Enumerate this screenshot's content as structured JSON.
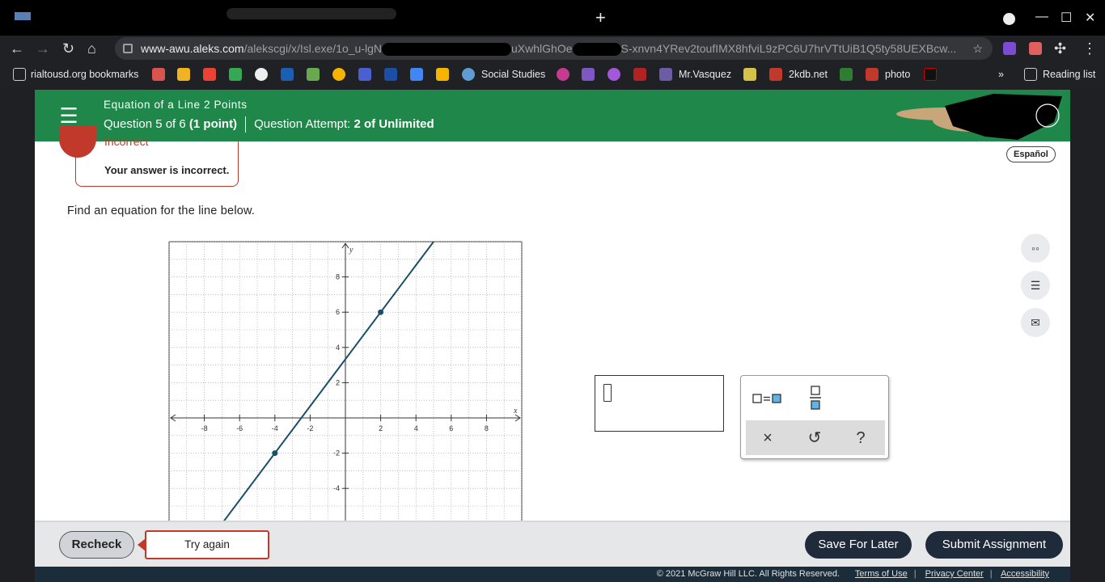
{
  "browser": {
    "url_host": "www-awu.aleks.com",
    "url_path_start": "/alekscgi/x/Isl.exe/1o_u-lgN",
    "url_path_mid": "uXwhlGhOe",
    "url_path_end": "S-xnvn4YRev2toufIMX8hfviL9zPC6U7hrVTtUiB1Q5ty58UEXBcw...",
    "new_tab_symbol": "+",
    "bookmarks": [
      {
        "label": "rialtousd.org bookmarks"
      },
      {
        "label": "Social Studies"
      },
      {
        "label": "Mr.Vasquez"
      },
      {
        "label": "2kdb.net"
      },
      {
        "label": "photo"
      }
    ],
    "bookmarks_more": "»",
    "reading_list": "Reading list"
  },
  "header": {
    "topic": "Equation of a Line 2 Points",
    "question_text": "Question 5 of 6",
    "question_points": "(1 point)",
    "attempt_label": "Question Attempt:",
    "attempt_value": "2 of Unlimited"
  },
  "feedback": {
    "status": "Incorrect",
    "message": "Your answer is incorrect."
  },
  "language_button": "Español",
  "problem": {
    "prompt": "Find an equation for the line below."
  },
  "graph": {
    "x_label": "x",
    "y_label": "y",
    "x_ticks": [
      -8,
      -6,
      -4,
      -2,
      2,
      4,
      6,
      8
    ],
    "y_ticks": [
      -4,
      -2,
      2,
      4,
      6,
      8
    ],
    "x_range": [
      -10,
      10
    ],
    "y_range": [
      -6,
      10
    ],
    "points": [
      [
        -4,
        -2
      ],
      [
        2,
        6
      ]
    ]
  },
  "keypad": {
    "clear": "×",
    "undo": "↺",
    "help": "?"
  },
  "footer": {
    "copyright": "© 2021 McGraw Hill LLC. All Rights Reserved.",
    "terms": "Terms of Use",
    "privacy": "Privacy Center",
    "accessibility": "Accessibility"
  },
  "actions": {
    "recheck": "Recheck",
    "try_again": "Try again",
    "save_later": "Save For Later",
    "submit": "Submit Assignment"
  }
}
